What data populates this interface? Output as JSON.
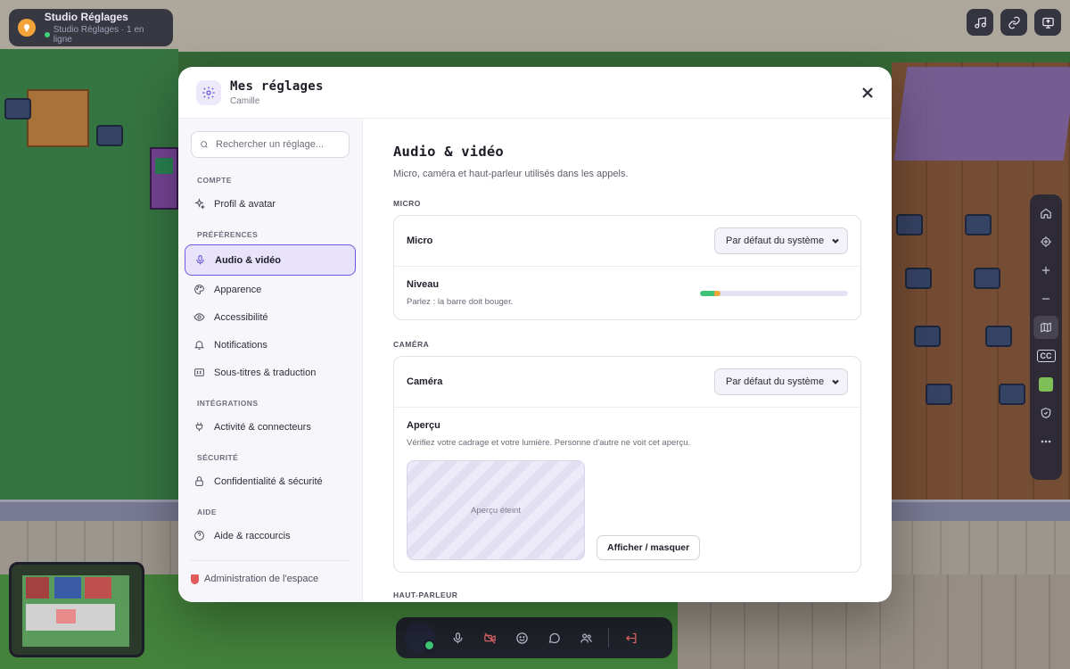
{
  "space": {
    "title": "Studio Réglages",
    "status": "Studio Réglages · 1 en ligne"
  },
  "icons": {
    "space_logo": "location-pin-icon",
    "top_right": [
      "music-icon",
      "link-icon",
      "screen-share-icon"
    ],
    "right_bar": [
      "home-icon",
      "locate-icon",
      "zoom-in-icon",
      "zoom-out-icon",
      "map-icon",
      "captions-icon",
      "puzzle-icon",
      "shield-icon",
      "more-icon"
    ],
    "media_bar": [
      "microphone-icon",
      "camera-off-icon",
      "emoji-icon",
      "chat-icon",
      "people-icon",
      "leave-icon"
    ]
  },
  "colors": {
    "accent": "#6a5ae0",
    "accent_bg": "#e8e3fb",
    "online": "#3fd07a",
    "level_low": "#3ec27a",
    "level_mid": "#f0a63a"
  },
  "right_bar": {
    "captions_label": "CC"
  },
  "modal": {
    "title": "Mes réglages",
    "subtitle": "Camille",
    "search_placeholder": "Rechercher un réglage...",
    "sections": {
      "compte": "COMPTE",
      "preferences": "PRÉFÉRENCES",
      "integrations": "INTÉGRATIONS",
      "securite": "SÉCURITÉ",
      "aide": "AIDE"
    },
    "nav": {
      "profil": "Profil & avatar",
      "audio": "Audio & vidéo",
      "apparence": "Apparence",
      "accessibilite": "Accessibilité",
      "notifications": "Notifications",
      "soustitres": "Sous-titres & traduction",
      "activite": "Activité & connecteurs",
      "confidentialite": "Confidentialité & sécurité",
      "aide": "Aide & raccourcis"
    },
    "footer": "Administration de l'espace"
  },
  "content": {
    "title": "Audio & vidéo",
    "subtitle": "Micro, caméra et haut-parleur utilisés dans les appels.",
    "micro_group": "MICRO",
    "micro_label": "Micro",
    "micro_select": "Par défaut du système",
    "level_label": "Niveau",
    "level_desc": "Parlez : la barre doit bouger.",
    "level_value": 0.14,
    "camera_group": "CAMÉRA",
    "camera_label": "Caméra",
    "camera_select": "Par défaut du système",
    "preview_label": "Aperçu",
    "preview_desc": "Vérifiez votre cadrage et votre lumière. Personne d'autre ne voit cet aperçu.",
    "preview_off": "Aperçu éteint",
    "toggle_button": "Afficher / masquer",
    "speaker_group": "HAUT-PARLEUR"
  }
}
